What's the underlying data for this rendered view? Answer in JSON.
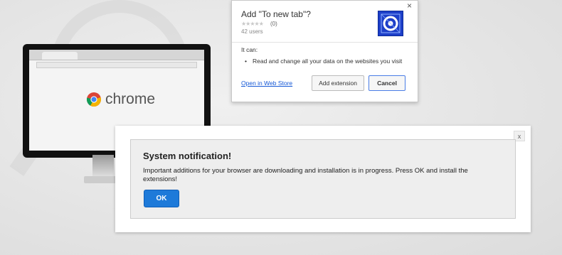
{
  "desktop": {
    "monitor_brand_text": "chrome"
  },
  "extension_dialog": {
    "title": "Add \"To new tab\"?",
    "rating_stars": "★★★★★",
    "rating_count": "(0)",
    "users": "42 users",
    "close_glyph": "×",
    "it_can_label": "It can:",
    "permissions": [
      "Read and change all your data on the websites you visit"
    ],
    "bullet": "•",
    "web_store_link": "Open in Web Store",
    "add_button": "Add extension",
    "cancel_button": "Cancel",
    "icon": "extension-app-icon",
    "icon_color": "#1d3fc9"
  },
  "notification": {
    "close_glyph": "x",
    "title": "System notification!",
    "body": "Important additions for your browser are downloading and installation is in progress. Press OK and install the extensions!",
    "ok_button": "OK",
    "ok_color": "#1e7ad9"
  }
}
